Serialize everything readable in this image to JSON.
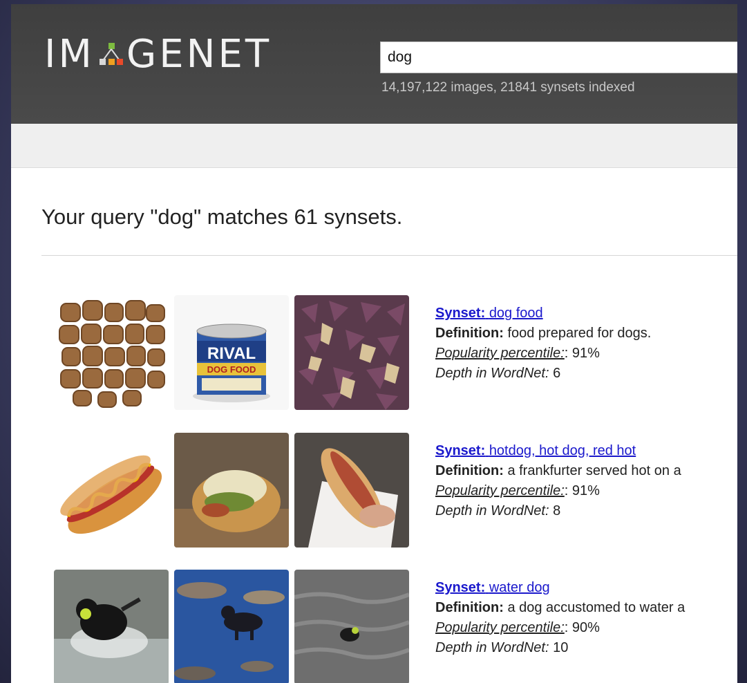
{
  "header": {
    "logo_left": "IM",
    "logo_right": "GENET",
    "search": {
      "value": "dog"
    },
    "index_info": "14,197,122 images, 21841 synsets indexed"
  },
  "main": {
    "query_title": "Your query \"dog\" matches 61 synsets.",
    "labels": {
      "synset": "Synset:",
      "definition": "Definition:",
      "popularity": "Popularity percentile:",
      "depth": "Depth in WordNet:"
    },
    "results": [
      {
        "name": "dog food",
        "definition": "food prepared for dogs.",
        "popularity": ": 91%",
        "depth": "6",
        "thumbnails": [
          "kibble-image",
          "rival-dog-food-can-image",
          "purple-kibble-image"
        ],
        "can_label": "RIVAL",
        "can_sublabel": "DOG FOOD"
      },
      {
        "name": "hotdog, hot dog, red hot",
        "definition": "a frankfurter served hot on a",
        "popularity": ": 91%",
        "depth": "8",
        "thumbnails": [
          "hotdog-mustard-image",
          "hotdog-relish-image",
          "hotdog-in-hand-image"
        ]
      },
      {
        "name": "water dog",
        "definition": "a dog accustomed to water a",
        "popularity": ": 90%",
        "depth": "10",
        "thumbnails": [
          "black-dog-splashing-image",
          "dog-in-river-image",
          "dog-swimming-image"
        ]
      }
    ]
  }
}
